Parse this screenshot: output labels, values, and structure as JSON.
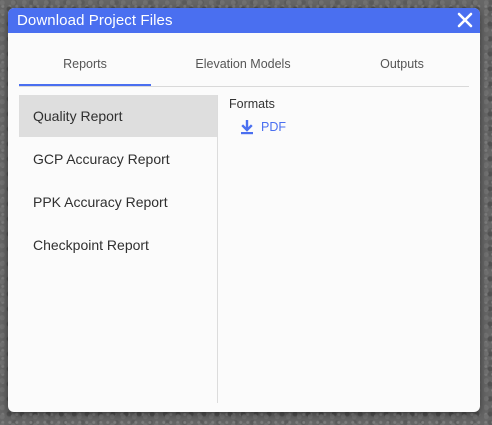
{
  "dialog": {
    "title": "Download Project Files",
    "close_icon": "close-icon"
  },
  "tabs": [
    {
      "label": "Reports",
      "active": true
    },
    {
      "label": "Elevation Models",
      "active": false
    },
    {
      "label": "Outputs",
      "active": false
    }
  ],
  "sidebar": {
    "items": [
      {
        "label": "Quality Report",
        "selected": true
      },
      {
        "label": "GCP Accuracy Report",
        "selected": false
      },
      {
        "label": "PPK Accuracy Report",
        "selected": false
      },
      {
        "label": "Checkpoint Report",
        "selected": false
      }
    ]
  },
  "content": {
    "formats_label": "Formats",
    "formats": [
      {
        "label": "PDF",
        "icon": "download-icon"
      }
    ]
  },
  "colors": {
    "accent": "#4a6ff0",
    "selected_bg": "#dedede"
  }
}
